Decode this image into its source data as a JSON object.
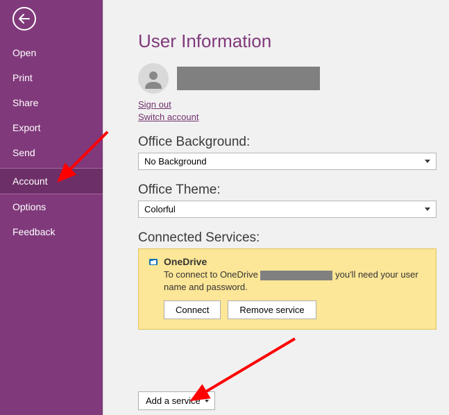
{
  "sidebar": {
    "items": [
      {
        "label": "Open"
      },
      {
        "label": "Print"
      },
      {
        "label": "Share"
      },
      {
        "label": "Export"
      },
      {
        "label": "Send"
      },
      {
        "label": "Account"
      },
      {
        "label": "Options"
      },
      {
        "label": "Feedback"
      }
    ]
  },
  "header": {
    "title": "User Information"
  },
  "user": {
    "sign_out": "Sign out",
    "switch_account": "Switch account"
  },
  "background": {
    "label": "Office Background:",
    "value": "No Background"
  },
  "theme": {
    "label": "Office Theme:",
    "value": "Colorful"
  },
  "connected": {
    "label": "Connected Services:",
    "service_name": "OneDrive",
    "desc_pre": "To connect to OneDrive",
    "desc_post": "you'll need your user name and password.",
    "connect_label": "Connect",
    "remove_label": "Remove service"
  },
  "add_service_label": "Add a service"
}
